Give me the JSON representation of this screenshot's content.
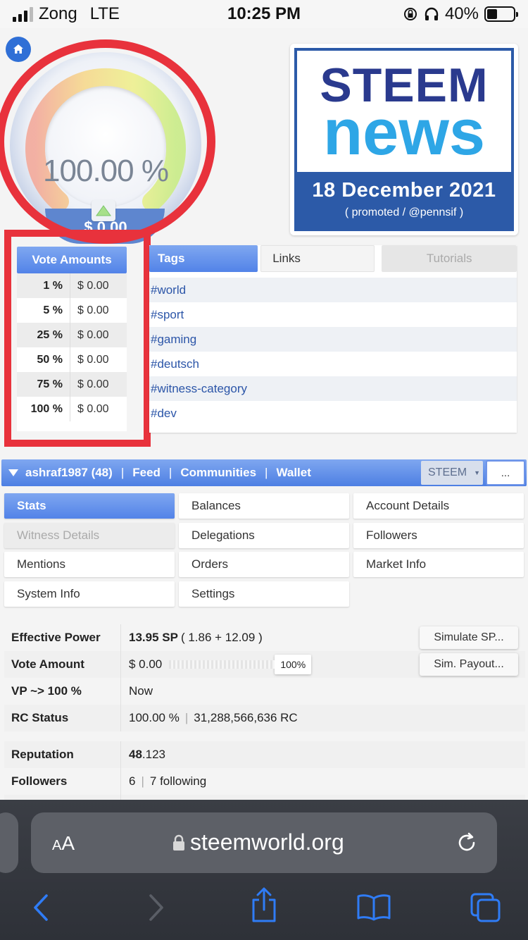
{
  "status_bar": {
    "carrier": "Zong",
    "network": "LTE",
    "time": "10:25 PM",
    "battery": "40%"
  },
  "gauge": {
    "percent": "100.00 %",
    "value": "$ 0.00"
  },
  "news": {
    "line1": "STEEM",
    "line2": "news",
    "date": "18 December 2021",
    "promo": "( promoted / @pennsif )"
  },
  "vote_amounts": {
    "header": "Vote Amounts",
    "rows": [
      {
        "pct": "1 %",
        "usd": "$ 0.00"
      },
      {
        "pct": "5 %",
        "usd": "$ 0.00"
      },
      {
        "pct": "25 %",
        "usd": "$ 0.00"
      },
      {
        "pct": "50 %",
        "usd": "$ 0.00"
      },
      {
        "pct": "75 %",
        "usd": "$ 0.00"
      },
      {
        "pct": "100 %",
        "usd": "$ 0.00"
      }
    ]
  },
  "tags_panel": {
    "tabs": [
      "Tags",
      "Links",
      "Tutorials"
    ],
    "tags": [
      "#world",
      "#sport",
      "#gaming",
      "#deutsch",
      "#witness-category",
      "#dev"
    ]
  },
  "userbar": {
    "user": "ashraf1987 (48)",
    "feed": "Feed",
    "communities": "Communities",
    "wallet": "Wallet",
    "currency": "STEEM",
    "more": "..."
  },
  "menu": [
    "Stats",
    "Balances",
    "Account Details",
    "Witness Details",
    "Delegations",
    "Followers",
    "Mentions",
    "Orders",
    "Market Info",
    "System Info",
    "Settings"
  ],
  "stats": {
    "effective_power": {
      "label": "Effective Power",
      "value": "13.95 SP",
      "detail": "( 1.86 + 12.09 )",
      "button": "Simulate SP..."
    },
    "vote_amount": {
      "label": "Vote Amount",
      "value": "$ 0.00",
      "slider_pct": "100%",
      "button": "Sim. Payout..."
    },
    "vp": {
      "label": "VP ~> 100 %",
      "value": "Now"
    },
    "rc_status": {
      "label": "RC Status",
      "pct": "100.00 %",
      "rc": "31,288,566,636 RC"
    },
    "reputation": {
      "label": "Reputation",
      "value_bold": "48",
      "value_rest": ".123"
    },
    "followers": {
      "label": "Followers",
      "count": "6",
      "following": "7 following"
    }
  },
  "safari": {
    "aa_small": "A",
    "aa_big": "A",
    "url": "steemworld.org"
  },
  "colors": {
    "accent": "#5283e8",
    "highlight": "#e8323c",
    "news_blue": "#2c5aa8"
  }
}
